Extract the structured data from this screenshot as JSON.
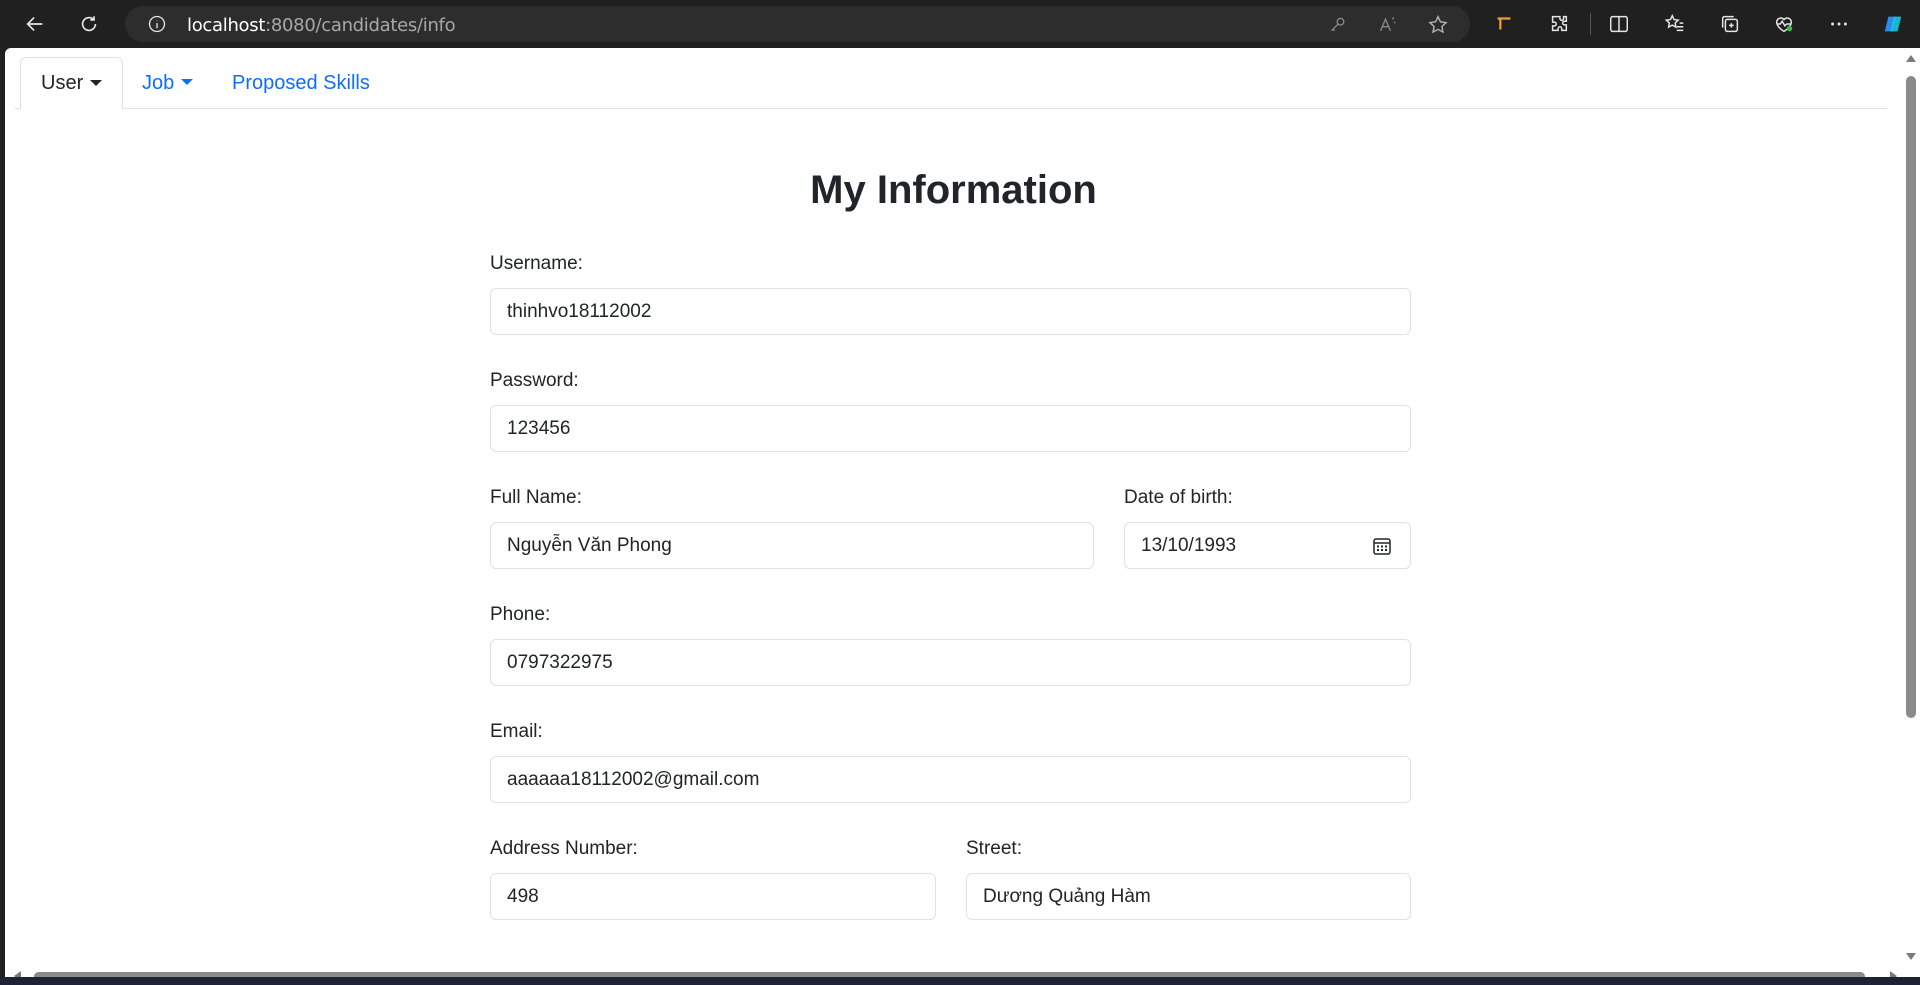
{
  "browser": {
    "url_host": "localhost",
    "url_path": ":8080/candidates/info"
  },
  "nav": {
    "user_label": "User",
    "job_label": "Job",
    "skills_label": "Proposed Skills"
  },
  "page": {
    "title": "My Information"
  },
  "form": {
    "username": {
      "label": "Username:",
      "value": "thinhvo18112002"
    },
    "password": {
      "label": "Password:",
      "value": "123456"
    },
    "full_name": {
      "label": "Full Name:",
      "value": "Nguyễn Văn Phong"
    },
    "dob": {
      "label": "Date of birth:",
      "value": "13/10/1993"
    },
    "phone": {
      "label": "Phone:",
      "value": "0797322975"
    },
    "email": {
      "label": "Email:",
      "value": "aaaaaa18112002@gmail.com"
    },
    "address_number": {
      "label": "Address Number:",
      "value": "498"
    },
    "street": {
      "label": "Street:",
      "value": "Dương Quảng Hàm"
    }
  },
  "colors": {
    "link": "#0d6efd",
    "text": "#212529",
    "border": "#dee2e6",
    "chrome_bg": "#202020"
  }
}
